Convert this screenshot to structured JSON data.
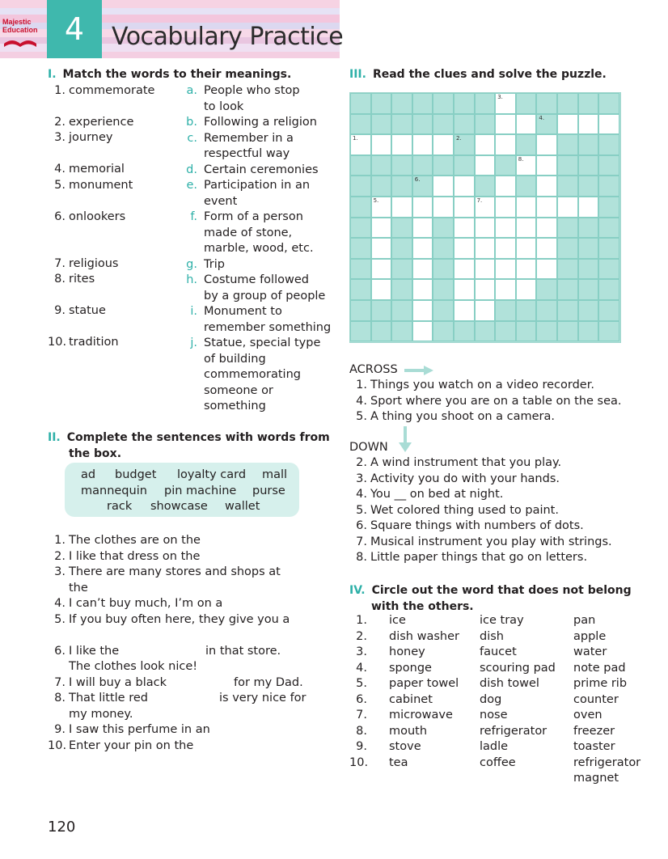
{
  "header": {
    "logo_line1": "Majestic",
    "logo_line2": "Education",
    "unit_number": "4",
    "title": "Vocabulary Practice"
  },
  "section1": {
    "roman": "I.",
    "heading": "Match the words to their meanings.",
    "words": [
      {
        "num": "1.",
        "text": "commemorate"
      },
      {
        "num": "2.",
        "text": "experience"
      },
      {
        "num": "3.",
        "text": "journey"
      },
      {
        "num": "4.",
        "text": "memorial"
      },
      {
        "num": "5.",
        "text": "monument"
      },
      {
        "num": "6.",
        "text": "onlookers"
      },
      {
        "num": "7.",
        "text": "religious"
      },
      {
        "num": "8.",
        "text": "rites"
      },
      {
        "num": "9.",
        "text": "statue"
      },
      {
        "num": "10.",
        "text": "tradition"
      }
    ],
    "meanings": [
      {
        "letter": "a.",
        "lines": [
          "People who stop",
          "to look"
        ]
      },
      {
        "letter": "b.",
        "lines": [
          "Following a religion"
        ]
      },
      {
        "letter": "c.",
        "lines": [
          "Remember in a",
          "respectful way"
        ]
      },
      {
        "letter": "d.",
        "lines": [
          "Certain ceremonies"
        ]
      },
      {
        "letter": "e.",
        "lines": [
          "Participation in an",
          "event"
        ]
      },
      {
        "letter": "f.",
        "lines": [
          "Form of a person",
          "made of stone,",
          "marble, wood, etc."
        ]
      },
      {
        "letter": "g.",
        "lines": [
          "Trip"
        ]
      },
      {
        "letter": "h.",
        "lines": [
          "Costume followed",
          "by a group of people"
        ]
      },
      {
        "letter": "i.",
        "lines": [
          "Monument to",
          "remember something"
        ]
      },
      {
        "letter": "j.",
        "lines": [
          "Statue, special type",
          "of building",
          "commemorating",
          "someone or",
          "something"
        ]
      }
    ]
  },
  "section2": {
    "roman": "II.",
    "heading_line1": "Complete the sentences with words from",
    "heading_line2": "the box.",
    "box_row1": [
      "ad",
      "budget",
      "loyalty card",
      "mall"
    ],
    "box_row2": [
      "mannequin",
      "pin machine",
      "purse"
    ],
    "box_row3": [
      "rack",
      "showcase",
      "wallet"
    ],
    "sentences": [
      {
        "num": "1.",
        "text": "The clothes are on the"
      },
      {
        "num": "2.",
        "text": "I like that dress on the"
      },
      {
        "num": "3.",
        "text": "There are many stores and shops at"
      },
      {
        "num": "",
        "text": "the"
      },
      {
        "num": "4.",
        "text": "I can’t buy much, I’m on a"
      },
      {
        "num": "5.",
        "text": "If you buy often here, they give you a"
      },
      {
        "num": "",
        "text": ""
      },
      {
        "num": "6.",
        "text": "I like the",
        "after": "in that store."
      },
      {
        "num": "",
        "text": "The clothes look nice!"
      },
      {
        "num": "7.",
        "text": "I will buy a black",
        "after": "for my Dad."
      },
      {
        "num": "8.",
        "text": "That little red",
        "after": "is very nice for"
      },
      {
        "num": "",
        "text": "my money."
      },
      {
        "num": "9.",
        "text": "I saw this perfume in an"
      },
      {
        "num": "10.",
        "text": "Enter your pin on the"
      }
    ]
  },
  "section3": {
    "roman": "III.",
    "heading": "Read the clues and solve the puzzle.",
    "across_label": "ACROSS",
    "across": [
      {
        "num": "1.",
        "text": "Things you watch on a video recorder."
      },
      {
        "num": "4.",
        "text": "Sport where you are on a table on the sea."
      },
      {
        "num": "5.",
        "text": "A thing you shoot on a camera."
      }
    ],
    "down_label": "DOWN",
    "down": [
      {
        "num": "2.",
        "text": "A wind instrument that you play."
      },
      {
        "num": "3.",
        "text": "Activity you do with your hands."
      },
      {
        "num": "4.",
        "text": "You __ on bed at night."
      },
      {
        "num": "5.",
        "text": "Wet colored thing used to paint."
      },
      {
        "num": "6.",
        "text": "Square things with numbers of dots."
      },
      {
        "num": "7.",
        "text": "Musical instrument you play with strings."
      },
      {
        "num": "8.",
        "text": "Little paper things that go on letters."
      }
    ],
    "grid_numbers": [
      "1.",
      "2.",
      "3.",
      "4.",
      "5.",
      "6.",
      "7.",
      "8."
    ]
  },
  "section4": {
    "roman": "IV.",
    "heading_line1": "Circle out the word that does not belong",
    "heading_line2": "with the others.",
    "rows": [
      {
        "num": "1.",
        "a": "ice",
        "b": "ice tray",
        "c": "pan"
      },
      {
        "num": "2.",
        "a": "dish washer",
        "b": "dish",
        "c": "apple"
      },
      {
        "num": "3.",
        "a": "honey",
        "b": "faucet",
        "c": "water"
      },
      {
        "num": "4.",
        "a": "sponge",
        "b": "scouring pad",
        "c": "note pad"
      },
      {
        "num": "5.",
        "a": "paper towel",
        "b": "dish towel",
        "c": "prime rib"
      },
      {
        "num": "6.",
        "a": "cabinet",
        "b": "dog",
        "c": "counter"
      },
      {
        "num": "7.",
        "a": "microwave",
        "b": "nose",
        "c": "oven"
      },
      {
        "num": "8.",
        "a": "mouth",
        "b": "refrigerator",
        "c": "freezer"
      },
      {
        "num": "9.",
        "a": "stove",
        "b": "ladle",
        "c": "toaster"
      },
      {
        "num": "10.",
        "a": "tea",
        "b": "coffee",
        "c": "refrigerator"
      }
    ],
    "last_extra": "magnet"
  },
  "page_number": "120",
  "colors": {
    "accent": "#2eb0a8",
    "grid_fill": "#b1e2da",
    "box_fill": "#d6f0ec"
  }
}
